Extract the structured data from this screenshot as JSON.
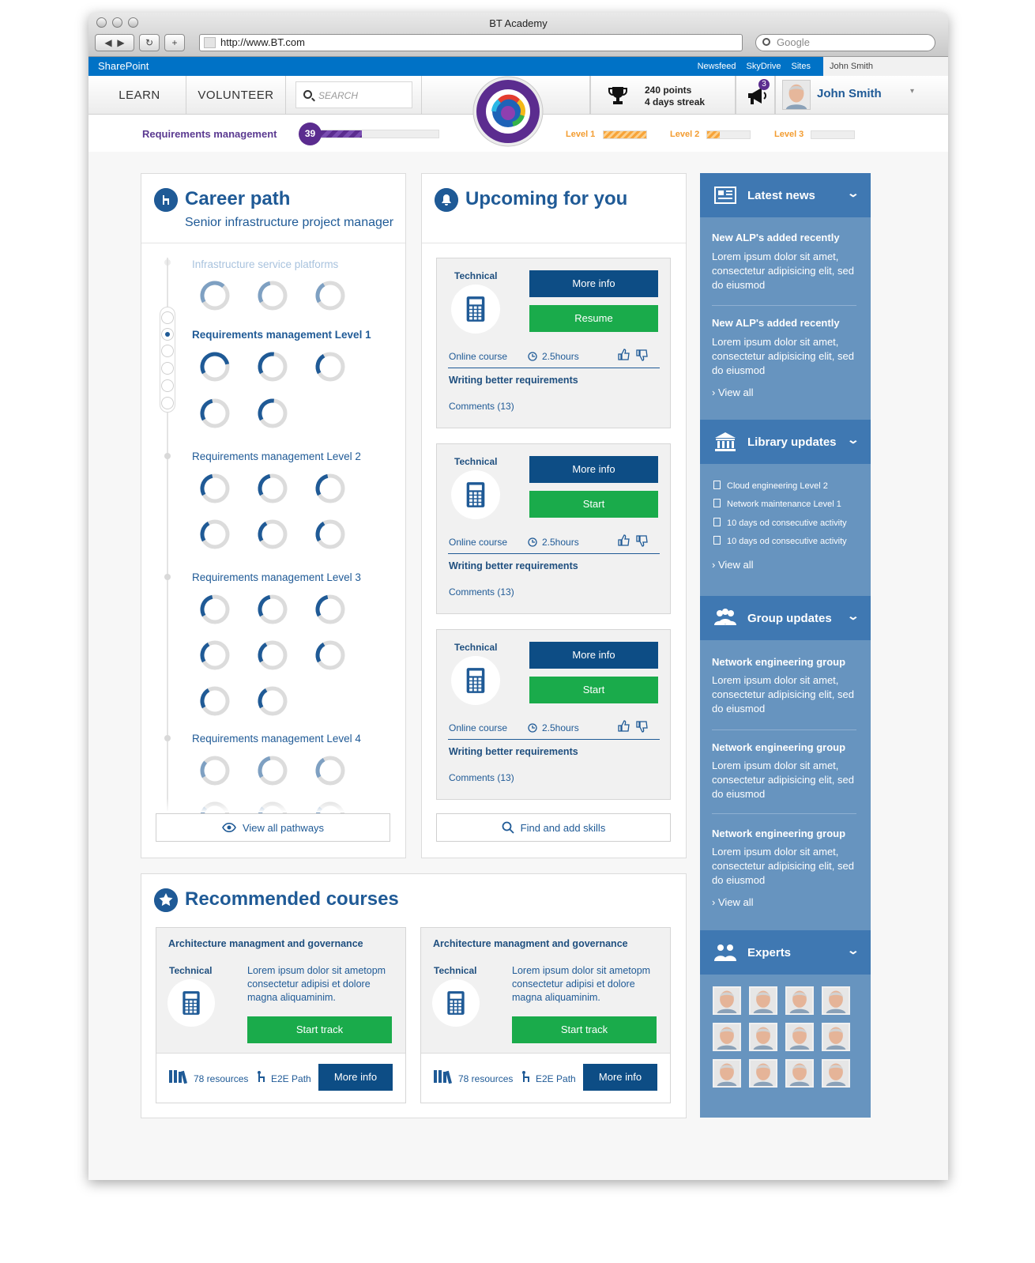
{
  "browser": {
    "title": "BT Academy",
    "url": "http://www.BT.com",
    "search_placeholder": "Google"
  },
  "sharepoint": {
    "brand": "SharePoint",
    "links": [
      "Newsfeed",
      "SkyDrive",
      "Sites"
    ],
    "user": "John Smith"
  },
  "nav": {
    "learn": "LEARN",
    "volunteer": "VOLUNTEER",
    "search_placeholder": "SEARCH",
    "points": "240 points",
    "streak": "4 days streak",
    "notifications": "3",
    "user_name": "John Smith"
  },
  "progress": {
    "label": "Requirements management",
    "value": "39",
    "fill_fraction": 0.4,
    "levels": [
      {
        "label": "Level 1",
        "fill_fraction": 1.0
      },
      {
        "label": "Level 2",
        "fill_fraction": 0.3
      },
      {
        "label": "Level 3",
        "fill_fraction": 0.0
      }
    ]
  },
  "career": {
    "title": "Career path",
    "subtitle": "Senior infrastructure project manager",
    "levels": [
      {
        "title": "Infrastructure service platforms",
        "faded": true
      },
      {
        "title": "Requirements management Level 1",
        "current": true
      },
      {
        "title": "Requirements management Level 2"
      },
      {
        "title": "Requirements management Level 3"
      },
      {
        "title": "Requirements management Level 4"
      }
    ],
    "view_all": "View all pathways"
  },
  "upcoming": {
    "title": "Upcoming for you",
    "cards": [
      {
        "tag": "Technical",
        "more": "More info",
        "action": "Resume",
        "type": "Online course",
        "duration": "2.5hours",
        "title": "Writing better requirements",
        "comments": "Comments (13)"
      },
      {
        "tag": "Technical",
        "more": "More info",
        "action": "Start",
        "type": "Online course",
        "duration": "2.5hours",
        "title": "Writing better requirements",
        "comments": "Comments (13)"
      },
      {
        "tag": "Technical",
        "more": "More info",
        "action": "Start",
        "type": "Online course",
        "duration": "2.5hours",
        "title": "Writing better requirements",
        "comments": "Comments (13)"
      }
    ],
    "find_skills": "Find and add skills"
  },
  "sidebar": {
    "news": {
      "title": "Latest news",
      "items": [
        {
          "heading": "New ALP's added recently",
          "body": "Lorem ipsum dolor sit amet, consectetur adipisicing elit, sed do eiusmod"
        },
        {
          "heading": "New ALP's added recently",
          "body": "Lorem ipsum dolor sit amet, consectetur adipisicing elit, sed do eiusmod"
        }
      ],
      "view_all": "View all"
    },
    "library": {
      "title": "Library updates",
      "items": [
        "Cloud engineering Level 2",
        "Network maintenance Level 1",
        "10 days od consecutive activity",
        "10 days od consecutive activity"
      ],
      "view_all": "View all"
    },
    "groups": {
      "title": "Group updates",
      "items": [
        {
          "heading": "Network engineering group",
          "body": "Lorem ipsum dolor sit amet, consectetur adipisicing elit, sed do eiusmod"
        },
        {
          "heading": "Network engineering group",
          "body": "Lorem ipsum dolor sit amet, consectetur adipisicing elit, sed do eiusmod"
        },
        {
          "heading": "Network engineering group",
          "body": "Lorem ipsum dolor sit amet, consectetur adipisicing elit, sed do eiusmod"
        }
      ],
      "view_all": "View all"
    },
    "experts": {
      "title": "Experts"
    }
  },
  "recommended": {
    "title": "Recommended courses",
    "cards": [
      {
        "title": "Architecture managment and governance",
        "tag": "Technical",
        "desc": "Lorem ipsum dolor sit ametopm consectetur adipisi et dolore magna aliquaminim.",
        "start": "Start track",
        "resources": "78 resources",
        "path": "E2E Path",
        "more": "More info"
      },
      {
        "title": "Architecture managment and governance",
        "tag": "Technical",
        "desc": "Lorem ipsum dolor sit ametopm consectetur adipisi et dolore magna aliquaminim.",
        "start": "Start track",
        "resources": "78 resources",
        "path": "E2E Path",
        "more": "More info"
      }
    ]
  },
  "colors": {
    "primary": "#1f5a96",
    "dark_button": "#0d4d85",
    "green": "#1aab4b",
    "purple": "#5b2c8f",
    "orange": "#f39c30",
    "sidebar": "#6794bf",
    "sidebar_head": "#3f78b2"
  }
}
